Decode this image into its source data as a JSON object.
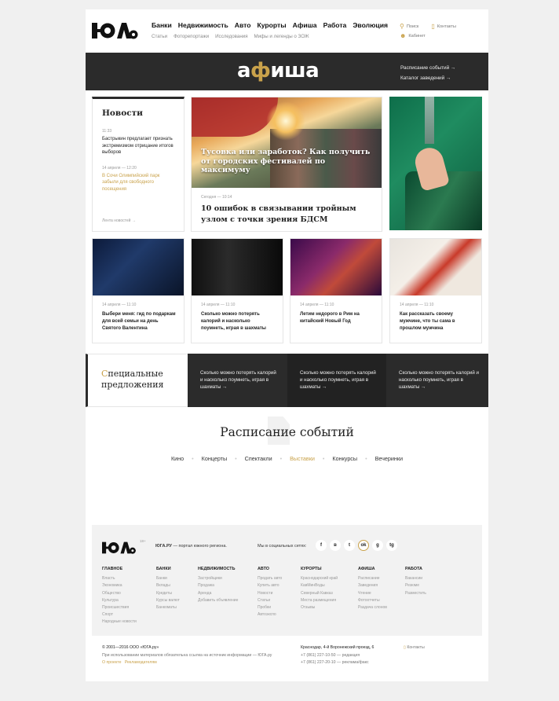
{
  "header": {
    "nav_main": [
      "Банки",
      "Недвижимость",
      "Авто",
      "Курорты",
      "Афиша",
      "Работа",
      "Эволюция"
    ],
    "nav_sub": [
      "Статьи",
      "Фоторепортажи",
      "Исследования",
      "Мифы и легенды о ЗОЖ"
    ],
    "search_label": "Поиск",
    "contacts_label": "Контакты",
    "cabinet_label": "Кабинет"
  },
  "afisha": {
    "title_before": "а",
    "title_special": "ф",
    "title_after": "иша",
    "link1": "Расписание событий →",
    "link2": "Каталог заведений →"
  },
  "news": {
    "heading": "Новости",
    "items": [
      {
        "time": "11:33",
        "text": "Бастрыкин предлагает признать экстремизмом отрицание итогов выборов"
      },
      {
        "time": "14 апреля — 12:20",
        "text": "В Сочи Олимпийский парк забыли для свободного посещения"
      }
    ],
    "more": "Лента новостей →"
  },
  "featured": {
    "image_caption": "Тусовка или заработок? Как получить от городских фестивалей по максимуму",
    "time": "Сегодня — 10:14",
    "title": "10 ошибок в связывании тройным узлом с точки зрения БДСМ"
  },
  "cards": [
    {
      "time": "14 апреля — 11:10",
      "text": "Выбери меня: гид по подаркам для всей семьи на день Святого Валентина"
    },
    {
      "time": "14 апреля — 11:10",
      "text": "Сколько можно потерять калорий и насколько поумнеть, играя в шахматы"
    },
    {
      "time": "14 апреля — 11:10",
      "text": "Летим недорого в Рим на китайский Новый Год"
    },
    {
      "time": "14 апреля — 11:10",
      "text": "Как рассказать своему мужчине, что ты сама в прошлом мужчина"
    }
  ],
  "offers": {
    "label_first": "С",
    "label_rest": "пециальные предложения",
    "tiles": [
      "Сколько можно потерять калорий и насколько поумнеть, играя в шахматы →",
      "Сколько можно потерять калорий и насколько поумнеть, играя в шахматы →",
      "Сколько можно потерять калорий и насколько поумнеть, играя в шахматы →"
    ]
  },
  "schedule": {
    "title": "Расписание событий",
    "tabs": [
      "Кино",
      "Концерты",
      "Спектакли",
      "Выставки",
      "Конкурсы",
      "Вечеринки"
    ],
    "active_tab": "Выставки"
  },
  "footer": {
    "age": "18+",
    "tagline_bold": "ЮГА.РУ",
    "tagline_rest": " — портал южного региона.",
    "social_label": "Мы в социальных сетях:",
    "social": [
      "f",
      "в",
      "t",
      "ok",
      "g",
      "tg"
    ],
    "columns": [
      {
        "heading": "ГЛАВНОЕ",
        "items": [
          "Власть",
          "Экономика",
          "Общество",
          "Культура",
          "Происшествия",
          "Спорт",
          "Народные новости"
        ]
      },
      {
        "heading": "БАНКИ",
        "items": [
          "Банки",
          "Вклады",
          "Кредиты",
          "Курсы валют",
          "Банкоматы"
        ]
      },
      {
        "heading": "НЕДВИЖИМОСТЬ",
        "items": [
          "Застройщики",
          "Продажа",
          "Аренда",
          "Добавить объявление"
        ]
      },
      {
        "heading": "АВТО",
        "items": [
          "Продать авто",
          "Купить авто",
          "Новости",
          "Статьи",
          "Пробки",
          "Автоэкспо"
        ]
      },
      {
        "heading": "КУРОРТЫ",
        "items": [
          "Краснодарский край",
          "КавМинВоды",
          "Северный Кавказ",
          "Места размещения",
          "Отзывы"
        ]
      },
      {
        "heading": "АФИША",
        "items": [
          "Расписание",
          "Заведения",
          "Чтение",
          "Фотоотчеты",
          "Раздача слонов"
        ]
      },
      {
        "heading": "РАБОТА",
        "items": [
          "Вакансии",
          "Резюме",
          "Разместить"
        ]
      }
    ],
    "copyright": "© 2001—2016 ООО «ЮГА.ру»",
    "notice": "При использовании материалов обязательна ссылка на источник информации — ЮГА.ру",
    "about": "О проекте",
    "advertisers": "Рекламодателям",
    "address": "Краснодар, 4-й Воронежский проезд, 6",
    "phone1": "+7 (861) 227-10-50 — редакция",
    "phone2": "+7 (861) 227-20-10 — реклама/факс",
    "contacts": "Контакты"
  },
  "colors": {
    "accent": "#c9a24b",
    "dark": "#2b2b2b"
  }
}
